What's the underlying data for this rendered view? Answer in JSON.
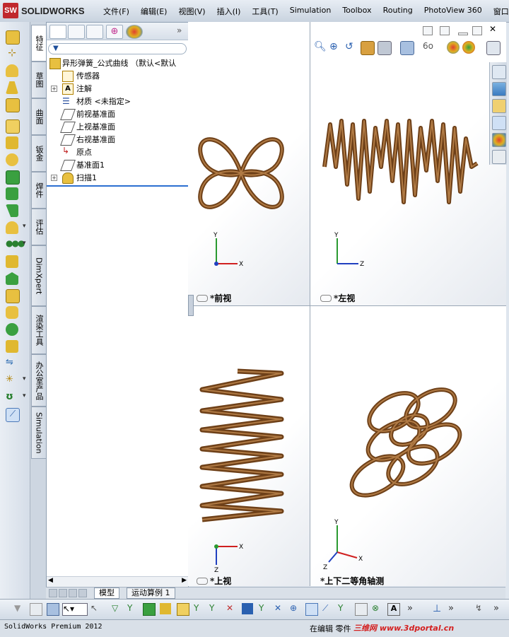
{
  "app": {
    "logo_text": "SOLIDWORKS",
    "logo_badge": "SW"
  },
  "menu": [
    "文件(F)",
    "编辑(E)",
    "视图(V)",
    "插入(I)",
    "工具(T)",
    "Simulation",
    "Toolbox",
    "Routing",
    "PhotoView 360",
    "窗口(W)"
  ],
  "vertical_tabs": [
    "特征",
    "草图",
    "曲面",
    "钣金",
    "焊件",
    "评估",
    "DimXpert",
    "渲染工具",
    "办公室产品",
    "Simulation"
  ],
  "feature_tree": {
    "root": "异形弹簧_公式曲线 （默认<默认",
    "items": [
      {
        "label": "传感器",
        "expandable": false,
        "icon": "sensor-icon"
      },
      {
        "label": "注解",
        "expandable": true,
        "icon": "annotation-icon"
      },
      {
        "label": "材质 <未指定>",
        "expandable": false,
        "icon": "material-icon"
      },
      {
        "label": "前视基准面",
        "expandable": false,
        "icon": "plane-icon"
      },
      {
        "label": "上视基准面",
        "expandable": false,
        "icon": "plane-icon"
      },
      {
        "label": "右视基准面",
        "expandable": false,
        "icon": "plane-icon"
      },
      {
        "label": "原点",
        "expandable": false,
        "icon": "origin-icon"
      },
      {
        "label": "基准面1",
        "expandable": false,
        "icon": "plane-icon"
      },
      {
        "label": "扫描1",
        "expandable": true,
        "icon": "sweep-icon"
      }
    ]
  },
  "bottom_tabs": [
    "模型",
    "运动算例 1"
  ],
  "viewports": {
    "front": {
      "label": "*前视",
      "axes": [
        "Y",
        "X"
      ]
    },
    "left": {
      "label": "*左视",
      "axes": [
        "Y",
        "Z"
      ]
    },
    "top": {
      "label": "*上视",
      "axes": [
        "X",
        "Z"
      ]
    },
    "iso": {
      "label": "*上下二等角轴测",
      "axes": [
        "Y",
        "X",
        "Z"
      ]
    }
  },
  "status": {
    "left": "SolidWorks Premium 2012",
    "right": "在编辑 零件",
    "watermark": "三维网 www.3dportal.cn"
  },
  "colors": {
    "spring": "#7a4a1e",
    "spring_highlight": "#b07a44",
    "accent": "#2c6fd1"
  }
}
